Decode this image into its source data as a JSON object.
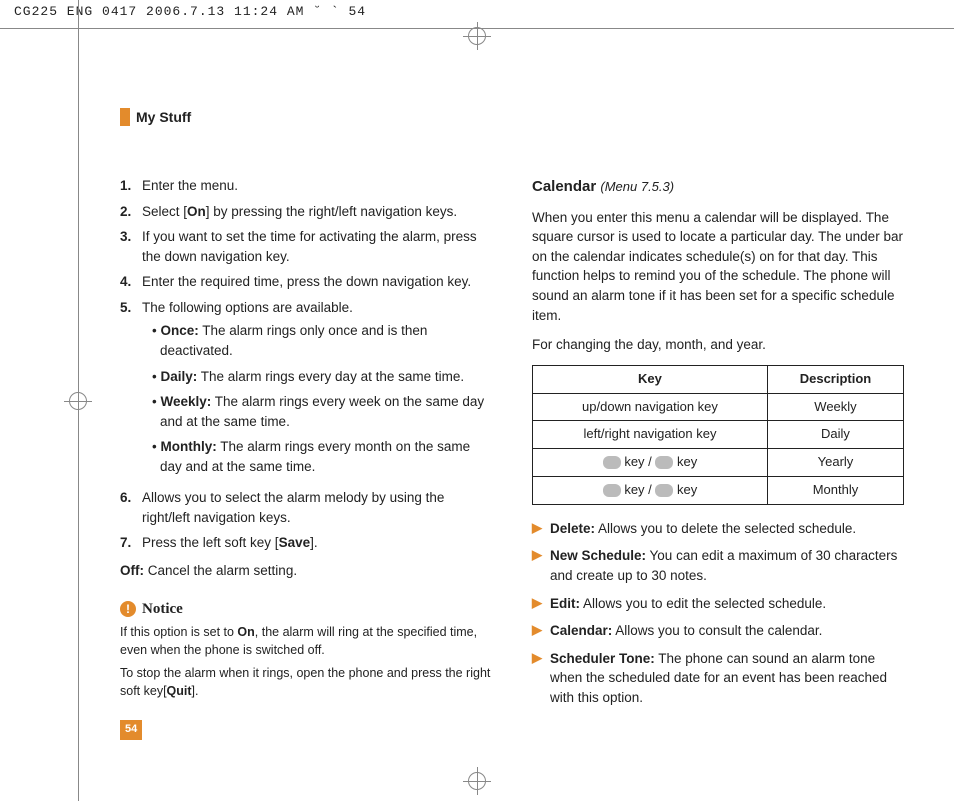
{
  "header": "CG225 ENG 0417  2006.7.13 11:24 AM  ˘  ` 54",
  "section_title": "My Stuff",
  "page_number": "54",
  "left": {
    "steps": [
      {
        "n": "1.",
        "text": "Enter the menu."
      },
      {
        "n": "2.",
        "prefix": "Select [",
        "bold": "On",
        "suffix": "] by pressing the right/left navigation keys."
      },
      {
        "n": "3.",
        "text": "If you want to set the time for activating the alarm, press the down navigation key."
      },
      {
        "n": "4.",
        "text": "Enter the required time, press the down navigation key."
      },
      {
        "n": "5.",
        "text": "The following options are available."
      },
      {
        "n": "6.",
        "text": "Allows you to select the alarm melody by using the right/left navigation keys."
      },
      {
        "n": "7.",
        "prefix": "Press the left soft key [",
        "bold": "Save",
        "suffix": "]."
      }
    ],
    "options": [
      {
        "label": "Once:",
        "text": " The alarm rings only once and is then deactivated."
      },
      {
        "label": "Daily:",
        "text": " The alarm rings every day at the same time."
      },
      {
        "label": "Weekly:",
        "text": " The alarm rings every week on the same day and at the same time."
      },
      {
        "label": "Monthly:",
        "text": " The alarm rings every month on the same day and at the same time."
      }
    ],
    "off": {
      "label": "Off:",
      "text": " Cancel the alarm setting."
    },
    "notice": {
      "title": "Notice",
      "p1a": "If this option is set to ",
      "p1b": "On",
      "p1c": ", the alarm will ring at the specified time, even when the phone is switched off.",
      "p2a": "To stop the alarm when it rings, open the phone and press the right soft key[",
      "p2b": "Quit",
      "p2c": "]."
    }
  },
  "right": {
    "cal_title": "Calendar",
    "cal_menu": "(Menu 7.5.3)",
    "para1": "When you enter this menu a calendar will be displayed. The square cursor is used to locate a particular day. The under bar on the calendar indicates schedule(s) on for that day. This function helps to remind you of the schedule. The phone will sound an alarm tone if it has been set for a specific schedule item.",
    "para2": "For changing the day, month, and year.",
    "table": {
      "h1": "Key",
      "h2": "Description",
      "rows": [
        {
          "k": "up/down navigation key",
          "d": "Weekly"
        },
        {
          "k": "left/right navigation key",
          "d": "Daily"
        },
        {
          "k_icons": true,
          "suffix": " key",
          "d": "Yearly"
        },
        {
          "k_icons": true,
          "suffix": " key",
          "d": "Monthly"
        }
      ]
    },
    "bullets": [
      {
        "label": "Delete:",
        "text": " Allows you to delete the selected schedule."
      },
      {
        "label": "New Schedule:",
        "text": " You can edit a maximum of 30 characters and create up to 30 notes."
      },
      {
        "label": "Edit:",
        "text": " Allows you to edit the selected schedule."
      },
      {
        "label": "Calendar:",
        "text": " Allows you to consult the calendar."
      },
      {
        "label": "Scheduler Tone:",
        "text": " The phone can sound an alarm tone when the scheduled date for an event has been reached with this option."
      }
    ]
  }
}
